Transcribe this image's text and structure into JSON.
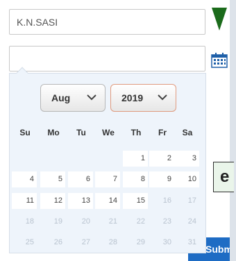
{
  "form": {
    "name_value": "K.N.SASI",
    "date_value": "",
    "submit_label": "Subm",
    "side_letter": "e"
  },
  "datepicker": {
    "month": "Aug",
    "year": "2019",
    "weekdays": [
      "Su",
      "Mo",
      "Tu",
      "We",
      "Th",
      "Fr",
      "Sa"
    ],
    "weeks": [
      [
        null,
        null,
        null,
        null,
        {
          "d": "1",
          "s": "a"
        },
        {
          "d": "2",
          "s": "a"
        },
        {
          "d": "3",
          "s": "a"
        }
      ],
      [
        {
          "d": "4",
          "s": "a"
        },
        {
          "d": "5",
          "s": "a"
        },
        {
          "d": "6",
          "s": "a"
        },
        {
          "d": "7",
          "s": "a"
        },
        {
          "d": "8",
          "s": "a"
        },
        {
          "d": "9",
          "s": "a"
        },
        {
          "d": "10",
          "s": "a"
        }
      ],
      [
        {
          "d": "11",
          "s": "a"
        },
        {
          "d": "12",
          "s": "a"
        },
        {
          "d": "13",
          "s": "a"
        },
        {
          "d": "14",
          "s": "a"
        },
        {
          "d": "15",
          "s": "a"
        },
        {
          "d": "16",
          "s": "d"
        },
        {
          "d": "17",
          "s": "d"
        }
      ],
      [
        {
          "d": "18",
          "s": "d"
        },
        {
          "d": "19",
          "s": "d"
        },
        {
          "d": "20",
          "s": "d"
        },
        {
          "d": "21",
          "s": "d"
        },
        {
          "d": "22",
          "s": "d"
        },
        {
          "d": "23",
          "s": "d"
        },
        {
          "d": "24",
          "s": "d"
        }
      ],
      [
        {
          "d": "25",
          "s": "d"
        },
        {
          "d": "26",
          "s": "d"
        },
        {
          "d": "27",
          "s": "d"
        },
        {
          "d": "28",
          "s": "d"
        },
        {
          "d": "29",
          "s": "d"
        },
        {
          "d": "30",
          "s": "d"
        },
        {
          "d": "31",
          "s": "d"
        }
      ]
    ]
  },
  "icons": {
    "dropdown": "triangle-down-icon",
    "calendar": "calendar-icon",
    "chevron": "chevron-down-icon"
  },
  "colors": {
    "triangle": "#1b6b1b",
    "calendar": "#1e5fa8",
    "submit": "#1e6cc4",
    "year_border": "#e09a7e"
  }
}
